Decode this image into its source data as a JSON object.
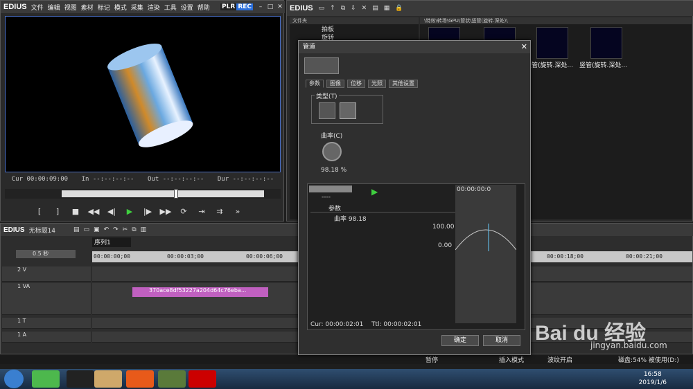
{
  "player": {
    "logo": "EDIUS",
    "menu": [
      "文件",
      "编辑",
      "视图",
      "素材",
      "标记",
      "模式",
      "采集",
      "渲染",
      "工具",
      "设置",
      "帮助"
    ],
    "plr": "PLR",
    "rec": "REC",
    "cur_label": "Cur",
    "cur_value": "00:00:09:00",
    "in_label": "In",
    "in_value": "--:--:--:--",
    "out_label": "Out",
    "out_value": "--:--:--:--",
    "dur_label": "Dur",
    "dur_value": "--:--:--:--"
  },
  "bin": {
    "logo": "EDIUS",
    "folder_header": "文件夹",
    "folders": [
      "拍板",
      "旋转"
    ],
    "path": "\\特效\\转场\\GPU\\管状\\竖管(旋转.深处)\\",
    "thumbs": [
      "竖管(旋转.深处...",
      "竖管(旋转.深处..."
    ]
  },
  "timeline": {
    "logo": "EDIUS",
    "project": "无标题14",
    "sequence_tab": "序列1",
    "zoom": "0.5 秒",
    "ruler": [
      "00:00:00;00",
      "00:00:03;00",
      "00:00:06;00",
      "00:00:18;00",
      "00:00:21;00"
    ],
    "tracks": [
      {
        "name": "2 V"
      },
      {
        "name": "1 VA"
      },
      {
        "name": "1 T"
      },
      {
        "name": "1 A"
      }
    ],
    "clip_name": "370ace8df53227a204d64c76eba..."
  },
  "status": {
    "pause": "暂停",
    "insert_mode": "插入模式",
    "ripple": "波纹开启",
    "disk": "磁盘:54% 被使用(D:)"
  },
  "dialog": {
    "title": "管道",
    "tabs": [
      "参数",
      "图像",
      "位移",
      "光照",
      "其他设置"
    ],
    "type_label": "类型(T)",
    "curvature_label": "曲率(C)",
    "curvature_value": "98.18 %",
    "kf_dropdown": "----",
    "kf_rows": [
      {
        "label": "参数"
      },
      {
        "label": "曲率",
        "value": "98.18"
      }
    ],
    "graph_max": "100.00",
    "graph_min": "0.00",
    "graph_tc": "00:00:00:0",
    "cur": "Cur: 00:00:02:01",
    "ttl": "Ttl: 00:00:02:01",
    "ok": "确定",
    "cancel": "取消"
  },
  "taskbar": {
    "time": "16:58",
    "date": "2019/1/6"
  },
  "watermark": {
    "brand": "Bai du 经验",
    "url": "jingyan.baidu.com"
  }
}
